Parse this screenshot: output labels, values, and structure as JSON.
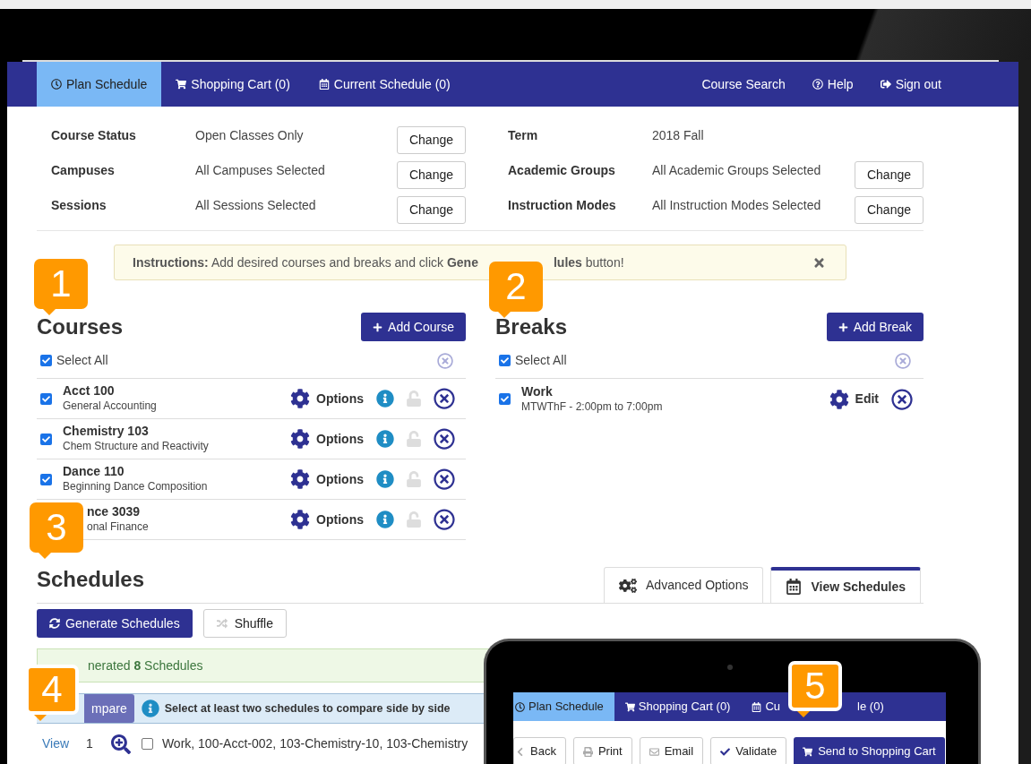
{
  "nav": {
    "tabs": [
      {
        "label": "Plan Schedule",
        "selected": true
      },
      {
        "label": "Shopping Cart (0)",
        "selected": false
      },
      {
        "label": "Current Schedule (0)",
        "selected": false
      }
    ],
    "links": [
      "Course Search",
      "Help",
      "Sign out"
    ]
  },
  "filters_left": [
    {
      "label": "Course Status",
      "value": "Open Classes Only",
      "button": "Change"
    },
    {
      "label": "Campuses",
      "value": "All Campuses Selected",
      "button": "Change"
    },
    {
      "label": "Sessions",
      "value": "All Sessions Selected",
      "button": "Change"
    }
  ],
  "filters_right": [
    {
      "label": "Term",
      "value": "2018 Fall"
    },
    {
      "label": "Academic Groups",
      "value": "All Academic Groups Selected",
      "button": "Change"
    },
    {
      "label": "Instruction Modes",
      "value": "All Instruction Modes Selected",
      "button": "Change"
    }
  ],
  "instructions": {
    "lead": "**Instructions:** Add desired courses and breaks and click **Gene**",
    "tail": "**lules** button!"
  },
  "courses": {
    "title": "Courses",
    "add_button": "Add Course",
    "select_all": {
      "label": "Select All",
      "checked": true
    },
    "items": [
      {
        "name": "Acct 100",
        "description": "General Accounting",
        "checked": true,
        "action": "Options"
      },
      {
        "name": "Chemistry 103",
        "description": "Chem Structure and Reactivity",
        "checked": true,
        "action": "Options"
      },
      {
        "name": "Dance 110",
        "description": "Beginning Dance Composition",
        "checked": true,
        "action": "Options"
      },
      {
        "name": "nce 3039",
        "description": "onal Finance",
        "action": "Options"
      }
    ]
  },
  "breaks": {
    "title": "Breaks",
    "add_button": "Add Break",
    "select_all": {
      "label": "Select All",
      "checked": true
    },
    "items": [
      {
        "name": "Work",
        "description": "MTWThF - 2:00pm to 7:00pm",
        "checked": true,
        "action": "Edit"
      }
    ]
  },
  "schedules": {
    "title": "Schedules",
    "tabs": [
      {
        "label": "Advanced Options",
        "selected": false
      },
      {
        "label": "View Schedules",
        "selected": true
      }
    ],
    "generate_button": "Generate Schedules",
    "shuffle_button": "Shuffle",
    "result": "nerated **8** Schedules",
    "compare_button": "mpare",
    "compare_hint": "Select at least two schedules to compare side by side",
    "rows": [
      {
        "link": "View",
        "number": "1",
        "checked": false,
        "courses": "Work, 100-Acct-002, 103-Chemistry-10, 103-Chemistry"
      }
    ]
  },
  "tablet": {
    "tabs": [
      {
        "label": "Plan Schedule",
        "selected": true
      },
      {
        "label": "Shopping Cart (0)",
        "selected": false
      },
      {
        "label": "Cu",
        "tail": "le (0)",
        "selected": false
      }
    ],
    "buttons": [
      {
        "label": "Back",
        "kind": "default"
      },
      {
        "label": "Print",
        "kind": "default"
      },
      {
        "label": "Email",
        "kind": "default"
      },
      {
        "label": "Validate",
        "kind": "default"
      },
      {
        "label": "Send to Shopping Cart",
        "kind": "primary"
      }
    ]
  },
  "badges": [
    "1",
    "2",
    "3",
    "4",
    "5"
  ]
}
